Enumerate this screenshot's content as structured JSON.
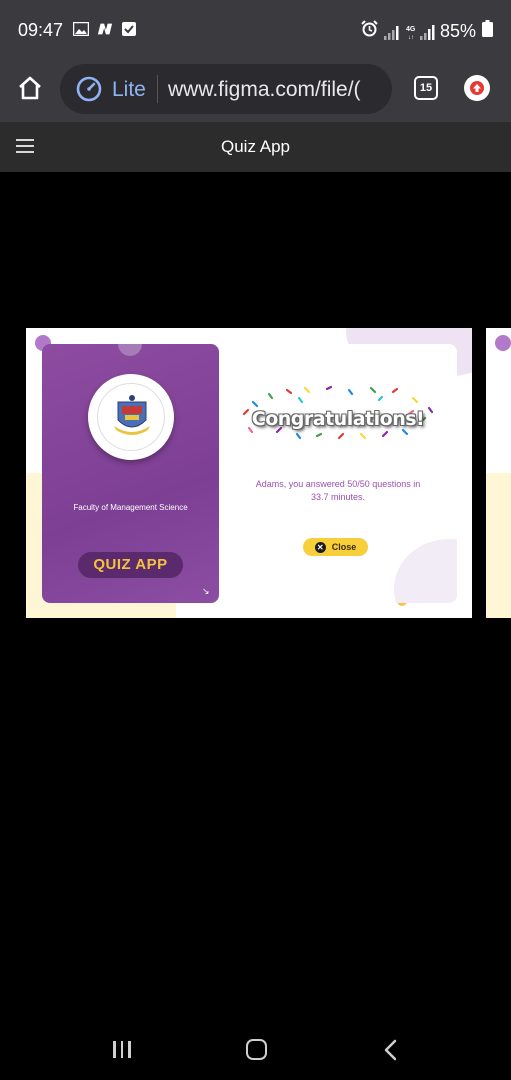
{
  "status_bar": {
    "time": "09:47",
    "icons": [
      "image-icon",
      "n-app-icon",
      "check-box-icon",
      "alarm-icon",
      "signal-icon",
      "4g-signal-icon",
      "battery-icon"
    ],
    "battery": "85%"
  },
  "browser": {
    "lite_label": "Lite",
    "url": "www.figma.com/file/(",
    "tab_count": "15"
  },
  "figma": {
    "title": "Quiz App"
  },
  "quiz": {
    "faculty_name": "Faculty of Management Science",
    "app_badge": "QUIZ  APP",
    "congrats": "Congratulations!",
    "result_message": "Adams, you answered 50/50 questions in 33.7 minutes.",
    "close_label": "Close"
  },
  "colors": {
    "purple": "#8d4ca0",
    "badge_yellow": "#f6c23e",
    "button_yellow": "#f7cf3a",
    "toolbar_bg": "#3b3b3f",
    "lite_blue": "#8fb3f5"
  }
}
